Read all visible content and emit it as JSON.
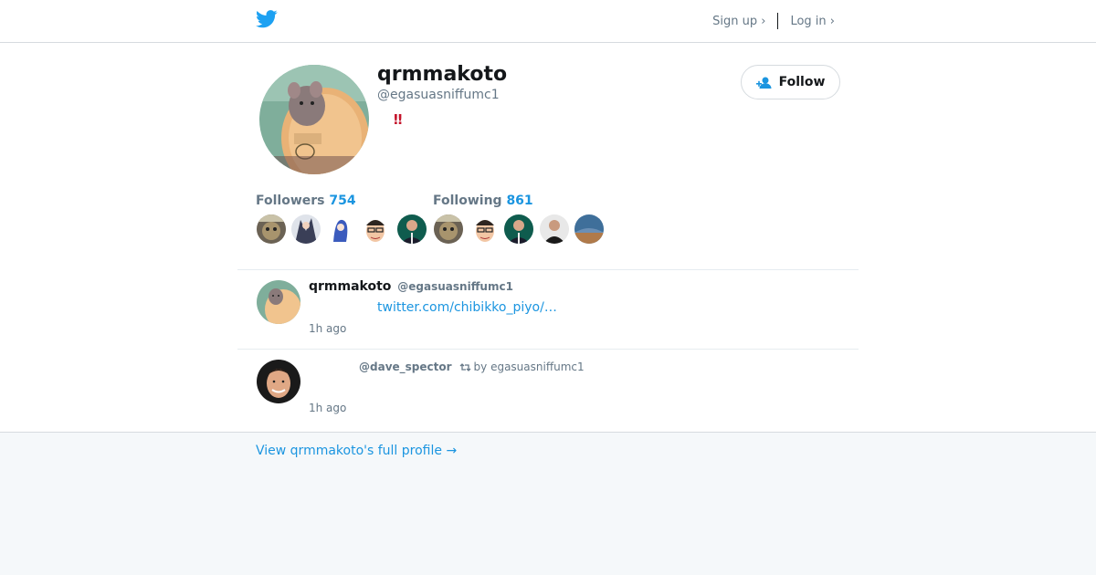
{
  "header": {
    "logo_icon": "twitter-bird-icon",
    "signup_label": "Sign up ›",
    "login_label": "Log in ›"
  },
  "profile": {
    "name": "qrmmakoto",
    "handle": "@egasuasniffumc1",
    "bio": "‼",
    "follow_label": "Follow",
    "followers_label": "Followers",
    "followers_count": "754",
    "following_label": "Following",
    "following_count": "861"
  },
  "tweets": [
    {
      "name": "qrmmakoto",
      "handle": "@egasuasniffumc1",
      "link": "twitter.com/chibikko_piyo/…",
      "time": "1h ago"
    },
    {
      "mention": "@dave_spector",
      "retweet_by": "by egasuasniffumc1",
      "time": "1h ago"
    }
  ],
  "footer": {
    "full_profile_link": "View qrmmakoto's full profile →"
  },
  "colors": {
    "accent": "#1b95e0",
    "text": "#14171a",
    "muted": "#657786",
    "background": "#f5f8fa"
  }
}
